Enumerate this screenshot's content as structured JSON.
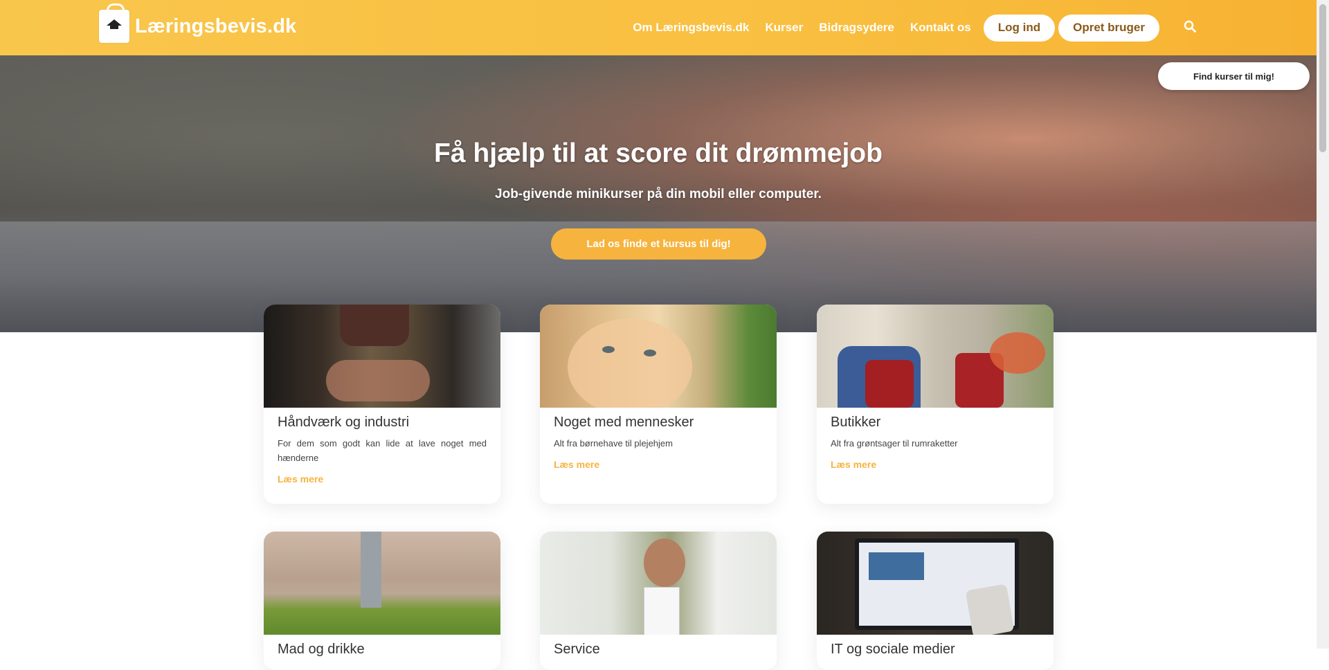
{
  "header": {
    "logo_text": "Læringsbevis.dk",
    "nav": [
      "Om Læringsbevis.dk",
      "Kurser",
      "Bidragsydere",
      "Kontakt os"
    ],
    "login": "Log ind",
    "signup": "Opret bruger",
    "search_icon": "search-icon"
  },
  "hero": {
    "title": "Få hjælp til at score dit drømmejob",
    "subtitle": "Job-givende minikurser på din mobil eller computer.",
    "cta": "Lad os finde et kursus til dig!",
    "find_button": "Find kurser til mig!"
  },
  "cards": [
    {
      "title": "Håndværk og industri",
      "desc": "For dem som godt kan lide at lave noget med hænderne",
      "link": "Læs mere"
    },
    {
      "title": "Noget med mennesker",
      "desc": "Alt fra børnehave til plejehjem",
      "link": "Læs mere"
    },
    {
      "title": "Butikker",
      "desc": "Alt fra grøntsager til rumraketter",
      "link": "Læs mere"
    },
    {
      "title": "Mad og drikke",
      "desc": "",
      "link": ""
    },
    {
      "title": "Service",
      "desc": "",
      "link": ""
    },
    {
      "title": "IT og sociale medier",
      "desc": "",
      "link": ""
    }
  ],
  "colors": {
    "accent": "#f6b33d",
    "header": "#f9c64c"
  }
}
